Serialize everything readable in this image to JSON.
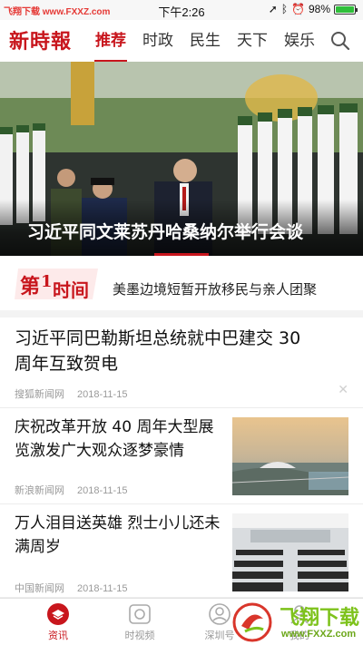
{
  "status_bar": {
    "site": "飞翔下载 www.FXXZ.com",
    "time": "下午2:26",
    "battery_percent": "98%",
    "battery_level": 0.98
  },
  "header": {
    "logo": "新時報",
    "tabs": [
      "推荐",
      "时政",
      "民生",
      "天下",
      "娱乐"
    ],
    "active_tab": 0,
    "search_icon": "search-icon"
  },
  "hero": {
    "title": "习近平同文莱苏丹哈桑纳尔举行会谈"
  },
  "first_time": {
    "logo_text_1": "第",
    "logo_text_2": "1",
    "logo_text_3": "时间",
    "headline": "美墨边境短暂开放移民与亲人团聚"
  },
  "news": [
    {
      "title_line1": "习近平同巴勒斯坦总统就中巴建交 30",
      "title_line2": "周年互致贺电",
      "source": "搜狐新闻网",
      "date": "2018-11-15"
    },
    {
      "title_line1": "庆祝改革开放 40 周年大型展",
      "title_line2": "览激发广大观众逐梦豪情",
      "source": "新浪新闻网",
      "date": "2018-11-15"
    },
    {
      "title_line1": "万人泪目送英雄 烈士小儿还未",
      "title_line2": "满周岁",
      "source": "中国新闻网",
      "date": "2018-11-15"
    }
  ],
  "bottom_nav": [
    {
      "label": "资讯",
      "icon": "news-icon",
      "active": true
    },
    {
      "label": "时视频",
      "icon": "video-icon",
      "active": false
    },
    {
      "label": "深圳号",
      "icon": "account-icon",
      "active": false
    },
    {
      "label": "我的",
      "icon": "me-icon",
      "active": false
    }
  ],
  "watermark": {
    "text": "飞翔下载",
    "url": "www.FXXZ.com"
  },
  "colors": {
    "brand_red": "#c8161d",
    "watermark_green": "#7dc21b"
  }
}
